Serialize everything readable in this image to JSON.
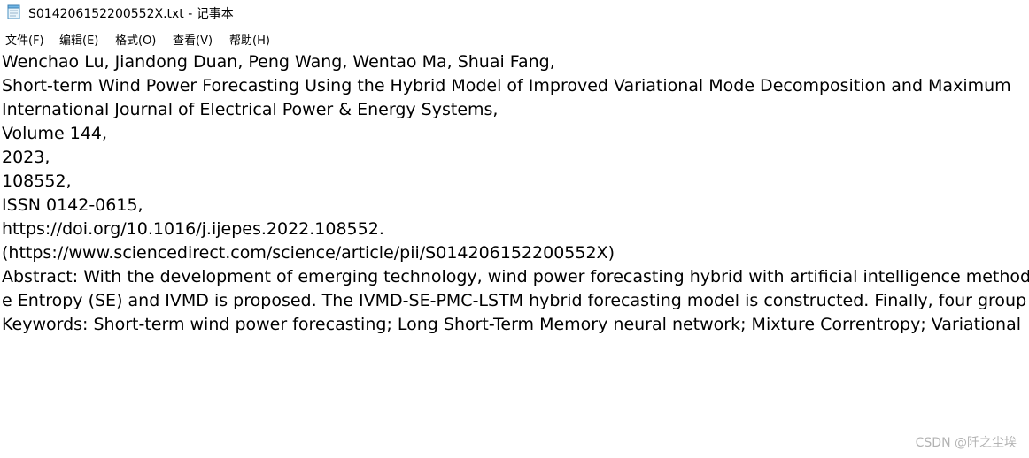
{
  "titlebar": {
    "title": "S014206152200552X.txt - 记事本",
    "icon": "notepad-icon"
  },
  "menubar": {
    "items": [
      {
        "label": "文件(F)"
      },
      {
        "label": "编辑(E)"
      },
      {
        "label": "格式(O)"
      },
      {
        "label": "查看(V)"
      },
      {
        "label": "帮助(H)"
      }
    ]
  },
  "editor": {
    "lines": [
      "Wenchao Lu, Jiandong Duan, Peng Wang, Wentao Ma, Shuai Fang,",
      "Short-term Wind Power Forecasting Using the Hybrid Model of Improved Variational Mode Decomposition and Maximum",
      "International Journal of Electrical Power & Energy Systems,",
      "Volume 144,",
      "2023,",
      "108552,",
      "ISSN 0142-0615,",
      "https://doi.org/10.1016/j.ijepes.2022.108552.",
      "(https://www.sciencedirect.com/science/article/pii/S014206152200552X)",
      "Abstract: With the development of emerging technology, wind power forecasting hybrid with artificial intelligence methods",
      "e Entropy (SE) and IVMD is proposed. The IVMD-SE-PMC-LSTM hybrid forecasting model is constructed. Finally, four group",
      "Keywords: Short-term wind power forecasting; Long Short-Term Memory neural network; Mixture Correntropy; Variational"
    ]
  },
  "watermark": "CSDN @阡之尘埃",
  "colors": {
    "background": "#ffffff",
    "text": "#000000",
    "watermark": "#b3b3b3"
  }
}
